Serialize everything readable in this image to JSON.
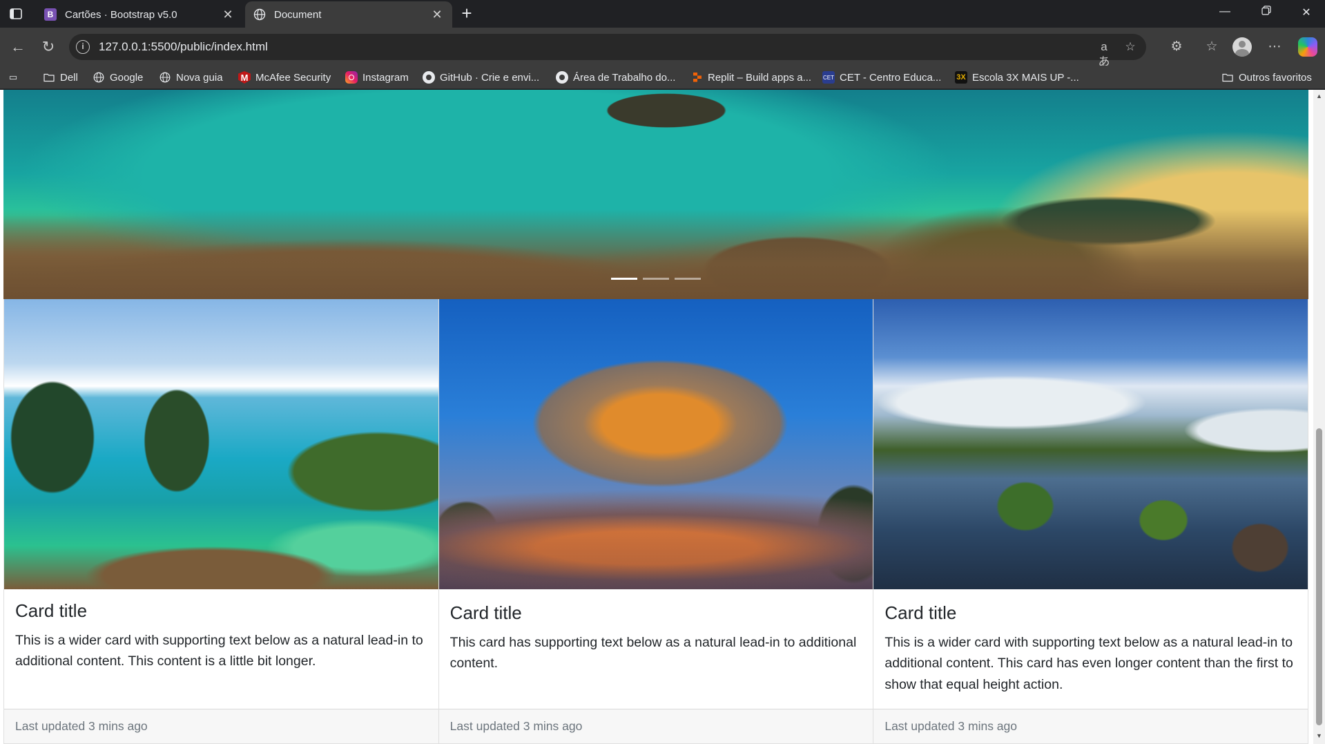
{
  "browser": {
    "tabs": [
      {
        "title": "Cartões · Bootstrap v5.0",
        "favicon": "bootstrap-logo-icon",
        "active": false
      },
      {
        "title": "Document",
        "favicon": "globe-icon",
        "active": true
      }
    ],
    "url": "127.0.0.1:5500/public/index.html",
    "bookmarks": [
      {
        "label": "Dell",
        "icon": "folder-icon"
      },
      {
        "label": "Google",
        "icon": "globe-icon"
      },
      {
        "label": "Nova guia",
        "icon": "globe-icon"
      },
      {
        "label": "McAfee Security",
        "icon": "mcafee-icon"
      },
      {
        "label": "Instagram",
        "icon": "instagram-icon"
      },
      {
        "label": "GitHub · Crie e envi...",
        "icon": "github-icon"
      },
      {
        "label": "Área de Trabalho do...",
        "icon": "github-icon"
      },
      {
        "label": "Replit – Build apps a...",
        "icon": "replit-icon"
      },
      {
        "label": "CET - Centro Educa...",
        "icon": "cet-icon"
      },
      {
        "label": "Escola 3X MAIS UP -...",
        "icon": "escola-icon"
      }
    ],
    "other_favorites": "Outros favoritos",
    "read_aloud_glyph": "aあ"
  },
  "page": {
    "carousel": {
      "indicators": [
        true,
        false,
        false
      ]
    },
    "cards": [
      {
        "title": "Card title",
        "text": "This is a wider card with supporting text below as a natural lead-in to additional content. This content is a little bit longer.",
        "footer": "Last updated 3 mins ago"
      },
      {
        "title": "Card title",
        "text": "This card has supporting text below as a natural lead-in to additional content.",
        "footer": "Last updated 3 mins ago"
      },
      {
        "title": "Card title",
        "text": "This is a wider card with supporting text below as a natural lead-in to additional content. This card has even longer content than the first to show that equal height action.",
        "footer": "Last updated 3 mins ago"
      }
    ]
  },
  "colors": {
    "chrome_dark": "#202124",
    "chrome_toolbar": "#3c3c3c",
    "bootstrap_purple": "#7952b3",
    "text_primary": "#212529",
    "text_muted": "#6c757d"
  }
}
